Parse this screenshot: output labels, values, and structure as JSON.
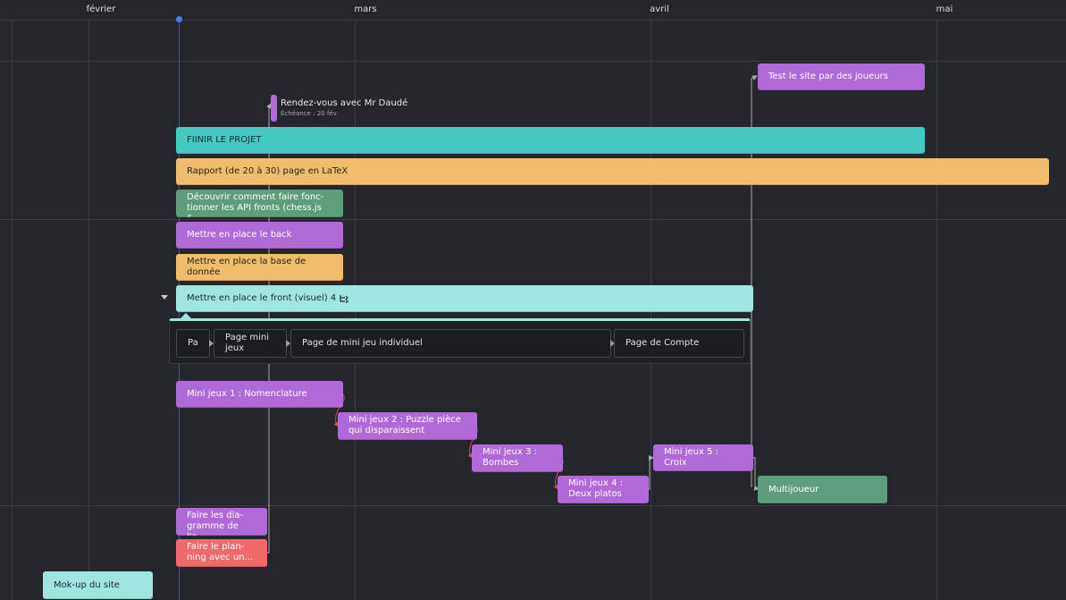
{
  "timeline": {
    "months": [
      "février",
      "mars",
      "avril",
      "mai"
    ]
  },
  "milestone": {
    "title": "Rendez-vous avec Mr Daudé",
    "due": "Échéance : 20 fév"
  },
  "tasks": {
    "test_site": "Test le site par des joueurs",
    "finir_projet": "FIINIR LE PROJET",
    "rapport": "Rapport (de 20 à 30) page en LaTeX",
    "api_line1": "Découvrir comment faire fonc-",
    "api_line2": "tionner les API fronts (chess.js &...",
    "back": "Mettre en place le back",
    "bdd": "Mettre en place la base de donnée",
    "front": "Mettre en place le front (visuel) 4",
    "mini1": "Mini jeux 1 : Nomenclature",
    "mini2_line1": "Mini jeux 2 : Puzzle pièce",
    "mini2_line2": "qui disparaissent",
    "mini3_line1": "Mini jeux 3 :",
    "mini3_line2": "Bombes",
    "mini4_line1": "Mini jeux 4 :",
    "mini4_line2": "Deux platos",
    "mini5": "Mini jeux 5 : Croix",
    "multijoueur": "Multijoueur",
    "diag_line1": "Faire les dia-",
    "diag_line2": "gramme de l'a...",
    "plan_line1": "Faire le plan-",
    "plan_line2": "ning avec un...",
    "mockup": "Mok-up du site"
  },
  "subtasks": {
    "pa": "Pa",
    "mini_line1": "Page mini",
    "mini_line2": "jeux",
    "individuel": "Page de mini jeu individuel",
    "compte": "Page de Compte"
  },
  "icons": {
    "subtask_count": "subtasks-icon",
    "collapse": "chevron-down-icon"
  },
  "colors": {
    "background": "#25262b",
    "purple": "#b06ad8",
    "teal": "#45c8c2",
    "light_teal": "#9fe6e2",
    "orange": "#f1bc6b",
    "green": "#5e9e7d",
    "red": "#ef6b6b",
    "today": "#4b7bec",
    "dependency_red": "#d9485f"
  }
}
